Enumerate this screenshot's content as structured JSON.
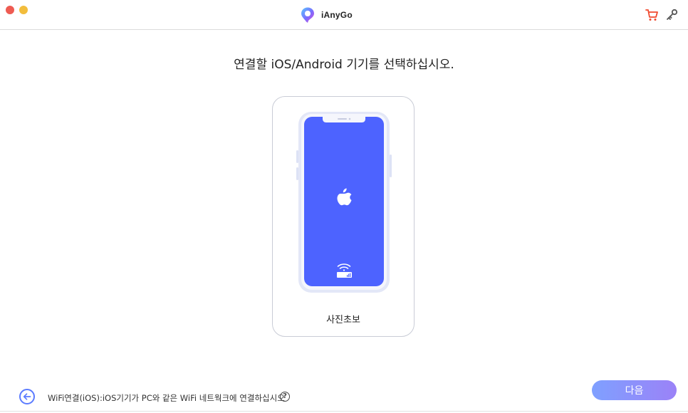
{
  "app": {
    "name": "iAnyGo"
  },
  "heading": "연결할 iOS/Android 기기를 선택하십시오.",
  "devices": [
    {
      "label": "사진초보",
      "os": "ios",
      "icon": "apple-icon",
      "connection_icon": "wifi-icon",
      "screen_color": "#4d63ff"
    }
  ],
  "footer": {
    "wifi_hint": "WiFi연결(iOS):iOS기기가 PC와 같은 WiFi 네트웍크에 연결하십시오",
    "help": "?",
    "next_label": "다음"
  },
  "icons": {
    "cart": "cart-icon",
    "key": "key-icon",
    "back": "back-arrow-icon"
  },
  "colors": {
    "accent": "#5b7bff",
    "cart": "#f04a2f",
    "button_gradient": [
      "#7fa0ff",
      "#9b82f7"
    ]
  }
}
